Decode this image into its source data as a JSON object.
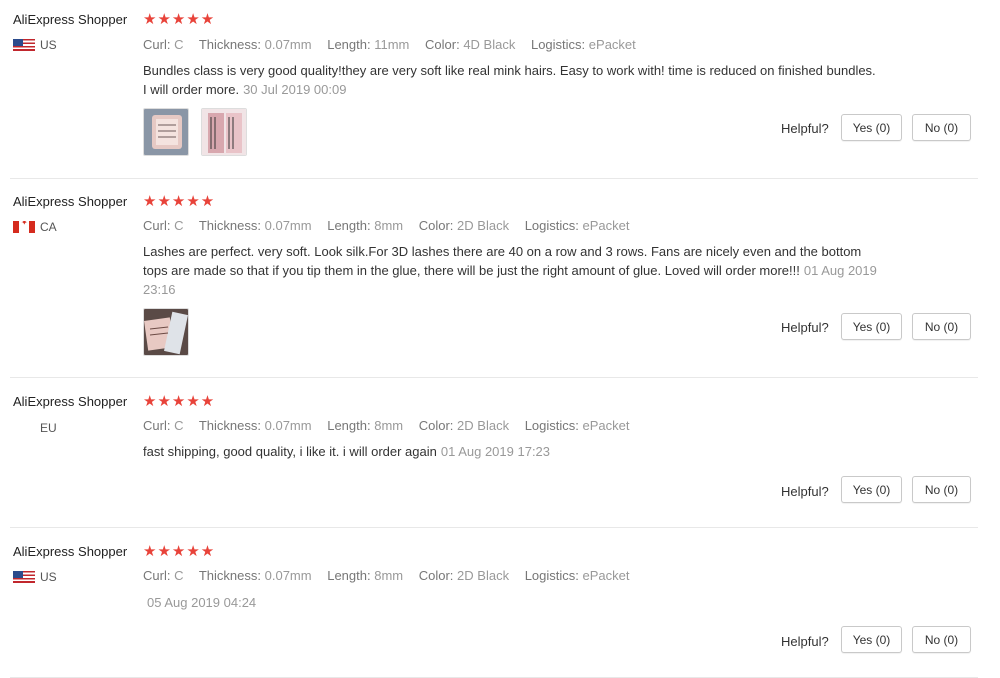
{
  "labels": {
    "curl": "Curl:",
    "thickness": "Thickness:",
    "length": "Length:",
    "color": "Color:",
    "logistics": "Logistics:",
    "helpful": "Helpful?"
  },
  "colors": {
    "star": "#e8433a",
    "muted_text": "#999999",
    "border": "#c9c9c9"
  },
  "reviews": [
    {
      "name": "AliExpress Shopper",
      "stars": "★★★★★",
      "rating": 5,
      "flag_icon": "us-flag-icon",
      "country": "US",
      "curl": "C",
      "thickness": "0.07mm",
      "length": "11mm",
      "color": "4D Black",
      "logistics": "ePacket",
      "text": "Bundles class is very good quality!they are very soft like real mink hairs. Easy to work with! time is reduced on finished bundles. I will order more.",
      "date": "30 Jul 2019 00:09",
      "yes": "Yes (0)",
      "no": "No (0)"
    },
    {
      "name": "AliExpress Shopper",
      "stars": "★★★★★",
      "rating": 5,
      "flag_icon": "ca-flag-icon",
      "country": "CA",
      "curl": "C",
      "thickness": "0.07mm",
      "length": "8mm",
      "color": "2D Black",
      "logistics": "ePacket",
      "text": "Lashes are perfect. very soft. Look silk.For 3D lashes there are 40 on a row and 3 rows. Fans are nicely even and the bottom tops are made so that if you tip them in the glue, there will be just the right amount of glue. Loved will order more!!!",
      "date": "01 Aug 2019 23:16",
      "yes": "Yes (0)",
      "no": "No (0)"
    },
    {
      "name": "AliExpress Shopper",
      "stars": "★★★★★",
      "rating": 5,
      "country": "EU",
      "curl": "C",
      "thickness": "0.07mm",
      "length": "8mm",
      "color": "2D Black",
      "logistics": "ePacket",
      "text": "fast shipping, good quality, i like it. i will order again",
      "date": "01 Aug 2019 17:23",
      "yes": "Yes (0)",
      "no": "No (0)"
    },
    {
      "name": "AliExpress Shopper",
      "stars": "★★★★★",
      "rating": 5,
      "flag_icon": "us-flag-icon",
      "country": "US",
      "curl": "C",
      "thickness": "0.07mm",
      "length": "8mm",
      "color": "2D Black",
      "logistics": "ePacket",
      "text": "",
      "date": "05 Aug 2019 04:24",
      "yes": "Yes (0)",
      "no": "No (0)"
    }
  ]
}
